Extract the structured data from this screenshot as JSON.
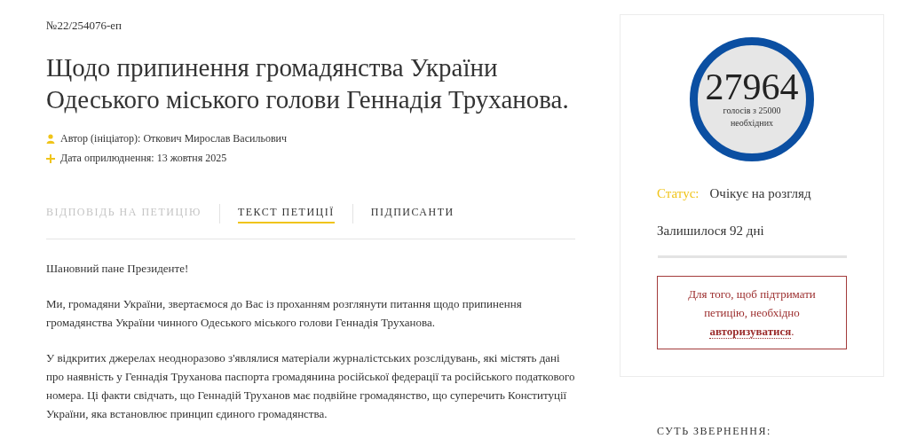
{
  "petition": {
    "number": "№22/254076-еп",
    "title": "Щодо припинення громадянства України Одеського міського голови Геннадія Труханова.",
    "meta": [
      {
        "kind": "author",
        "text": "Автор (ініціатор): Откович Мирослав Васильович"
      },
      {
        "kind": "date",
        "text": "Дата оприлюднення: 13 жовтня 2025"
      }
    ],
    "tabs": [
      {
        "label": "ВІДПОВІДЬ НА ПЕТИЦІЮ",
        "selected": false,
        "disabled": true
      },
      {
        "label": "ТЕКСТ ПЕТИЦІЇ",
        "selected": true,
        "disabled": false
      },
      {
        "label": "ПІДПИСАНТИ",
        "selected": false,
        "disabled": false
      }
    ],
    "paragraphs": [
      "Шановний пане Президенте!",
      "Ми, громадяни України, звертаємося до Вас із проханням розглянути питання щодо припинення громадянства України чинного Одеського міського голови Геннадія Труханова.",
      "У відкритих джерелах неодноразово з'являлися матеріали журналістських розслідувань, які містять дані про наявність у Геннадія Труханова паспорта громадянина російської федерації та російського податкового номера. Ці факти свідчать, що Геннадій Труханов має подвійне громадянство, що суперечить Конституції України, яка встановлює принцип єдиного громадянства."
    ]
  },
  "sidebar": {
    "votes": "27964",
    "votes_caption": "голосів з 25000 необхідних",
    "status_label": "Статус:",
    "status_value": "Очікує на розгляд",
    "remaining": "Залишилося 92 дні",
    "notice": "Для того, щоб підтримати петицію, необхідно",
    "notice_link": "авторизуватися",
    "notice_end": ".",
    "section_heading": "СУТЬ ЗВЕРНЕННЯ:"
  }
}
